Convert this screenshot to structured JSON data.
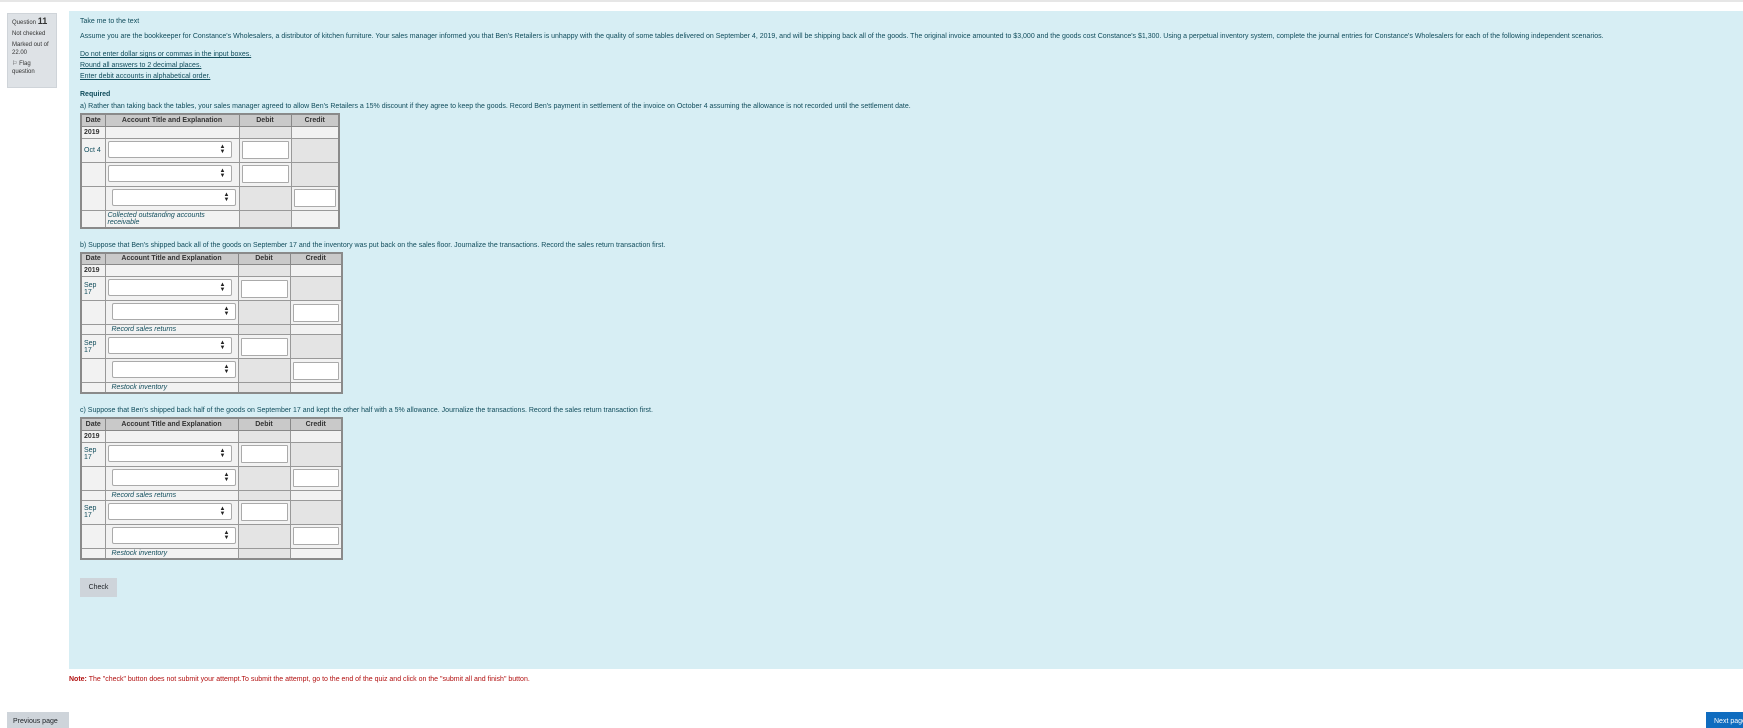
{
  "question_info": {
    "label": "Question",
    "number": "11",
    "status": "Not checked",
    "marked_out_of": "Marked out of 22.00",
    "flag_label": "Flag question"
  },
  "content": {
    "link": "Take me to the text",
    "intro": "Assume you are the bookkeeper for Constance's Wholesalers, a distributor of kitchen furniture. Your sales manager informed you that Ben's Retailers is unhappy with the quality of some tables delivered on September 4, 2019, and will be shipping back all of the goods. The original invoice amounted to $3,000 and the goods cost Constance's $1,300. Using a perpetual inventory system, complete the journal entries for Constance's Wholesalers for each of the following independent scenarios.",
    "instructions": [
      "Do not enter dollar signs or commas in the input boxes.",
      "Round all answers to 2 decimal places.",
      "Enter debit accounts in alphabetical order."
    ],
    "required_label": "Required",
    "headers": {
      "date": "Date",
      "account": "Account Title and Explanation",
      "debit": "Debit",
      "credit": "Credit"
    },
    "year": "2019",
    "part_a": {
      "text": "a) Rather than taking back the tables, your sales manager agreed to allow Ben's Retailers a 15% discount if they agree to keep the goods. Record Ben's payment in settlement of the invoice on October 4 assuming the allowance is not recorded until the settlement date.",
      "date": "Oct 4",
      "explanation": "Collected outstanding accounts receivable"
    },
    "part_b": {
      "text": "b) Suppose that Ben's shipped back all of the goods on September 17 and the inventory was put back on the sales floor. Journalize the transactions. Record the sales return transaction first.",
      "date1": "Sep 17",
      "explanation1": "Record sales returns",
      "date2": "Sep 17",
      "explanation2": "Restock inventory"
    },
    "part_c": {
      "text": "c) Suppose that Ben's shipped back half of the goods on September 17 and kept the other half with a 5% allowance. Journalize the transactions. Record the sales return transaction first.",
      "date1": "Sep 17",
      "explanation1": "Record sales returns",
      "date2": "Sep 17",
      "explanation2": "Restock inventory"
    },
    "check_label": "Check"
  },
  "note": {
    "label": "Note:",
    "text": " The \"check\" button does not submit your attempt.To submit the attempt, go to the end of the quiz and click on the \"submit all and finish\" button."
  },
  "nav": {
    "previous": "Previous page",
    "next": "Next page"
  }
}
